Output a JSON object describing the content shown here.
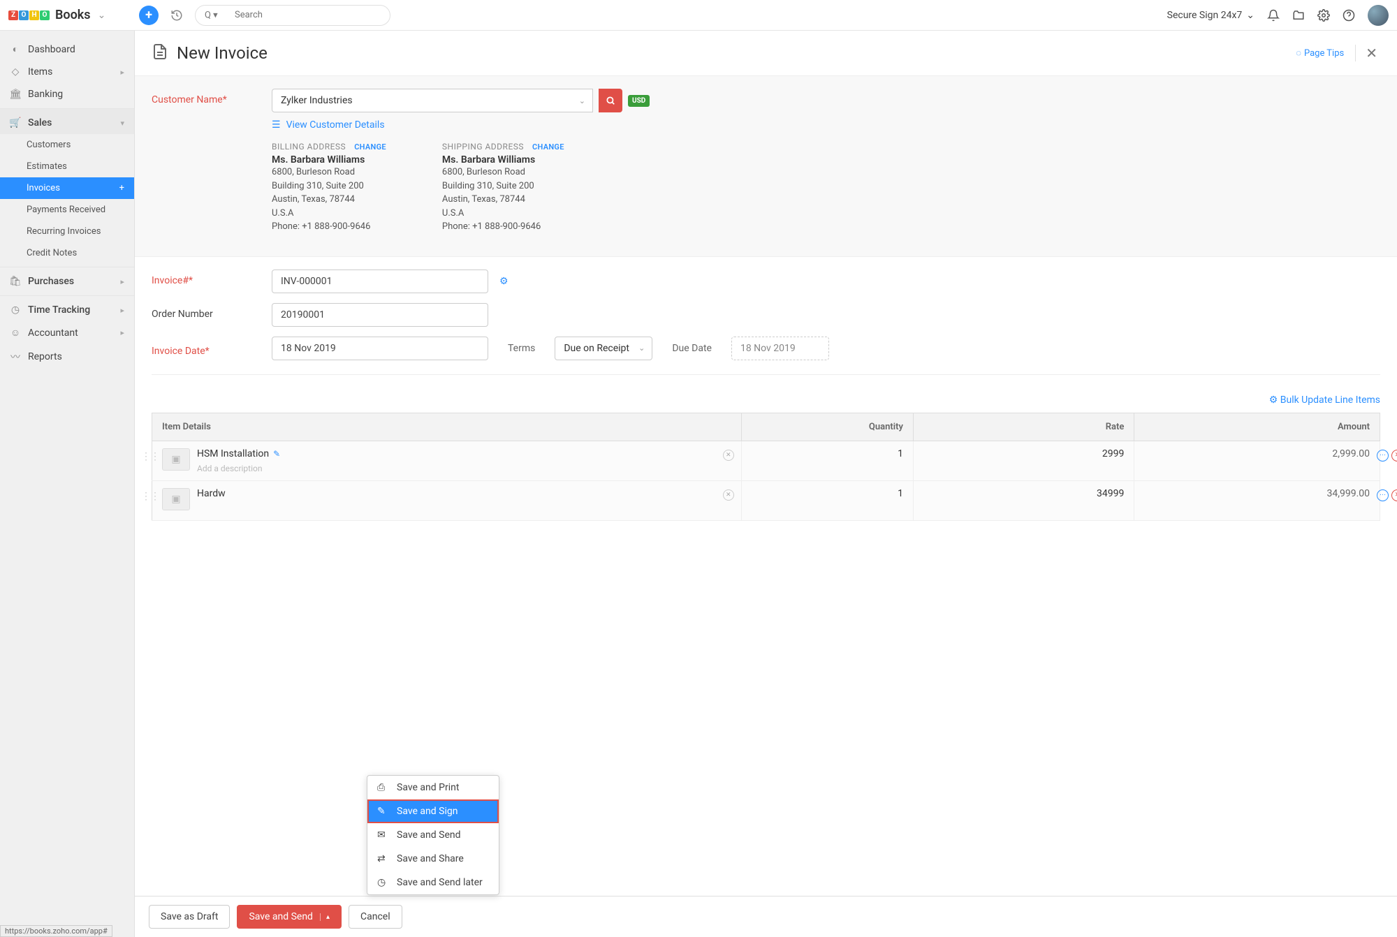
{
  "topbar": {
    "app_name": "Books",
    "logo_letters": [
      "Z",
      "O",
      "H",
      "O"
    ],
    "logo_colors": [
      "#e74c3c",
      "#3498db",
      "#f1c40f",
      "#2ecc71"
    ],
    "search_prefix": "Q ▾",
    "search_placeholder": "Search",
    "org_name": "Secure Sign 24x7"
  },
  "sidebar": {
    "items": [
      {
        "label": "Dashboard"
      },
      {
        "label": "Items"
      },
      {
        "label": "Banking"
      }
    ],
    "sales": {
      "label": "Sales",
      "expanded": true
    },
    "sales_items": [
      "Customers",
      "Estimates",
      "Invoices",
      "Payments Received",
      "Recurring Invoices",
      "Credit Notes"
    ],
    "active_sub": "Invoices",
    "after": [
      {
        "label": "Purchases"
      },
      {
        "label": "Time Tracking"
      },
      {
        "label": "Accountant"
      },
      {
        "label": "Reports"
      }
    ]
  },
  "page": {
    "title": "New Invoice",
    "tips": "Page Tips"
  },
  "form": {
    "customer_label": "Customer Name*",
    "customer_value": "Zylker Industries",
    "currency": "USD",
    "view_customer": "View Customer Details",
    "billing_head": "BILLING ADDRESS",
    "shipping_head": "SHIPPING ADDRESS",
    "change_label": "CHANGE",
    "addr": {
      "name": "Ms. Barbara Williams",
      "l1": "6800, Burleson Road",
      "l2": "Building 310, Suite 200",
      "l3": "Austin, Texas, 78744",
      "l4": "U.S.A",
      "l5": "Phone: +1 888-900-9646"
    },
    "invoice_no_label": "Invoice#*",
    "invoice_no_value": "INV-000001",
    "order_no_label": "Order Number",
    "order_no_value": "20190001",
    "invoice_date_label": "Invoice Date*",
    "invoice_date_value": "18 Nov 2019",
    "terms_label": "Terms",
    "terms_value": "Due on Receipt",
    "due_date_label": "Due Date",
    "due_date_value": "18 Nov 2019",
    "bulk_update": "Bulk Update Line Items"
  },
  "table": {
    "headers": [
      "Item Details",
      "Quantity",
      "Rate",
      "Amount"
    ],
    "add_desc": "Add a description",
    "rows": [
      {
        "name": "HSM Installation",
        "qty": "1",
        "rate": "2999",
        "amount": "2,999.00"
      },
      {
        "name": "Hardw",
        "qty": "1",
        "rate": "34999",
        "amount": "34,999.00"
      }
    ]
  },
  "footer": {
    "draft": "Save as Draft",
    "save_send": "Save and Send",
    "cancel": "Cancel"
  },
  "save_menu": [
    "Save and Print",
    "Save and Sign",
    "Save and Send",
    "Save and Share",
    "Save and Send later"
  ],
  "save_menu_highlight": 1,
  "status_url": "https://books.zoho.com/app#"
}
